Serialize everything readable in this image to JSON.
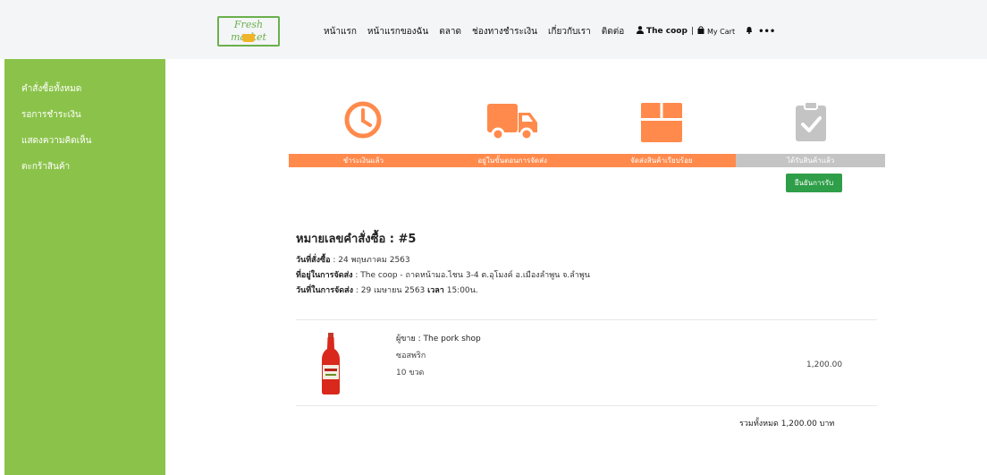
{
  "brand": {
    "logo_text": "Fresh market"
  },
  "nav": {
    "items": [
      "หน้าแรก",
      "หน้าแรกของฉัน",
      "ตลาด",
      "ช่องทางชำระเงิน",
      "เกี่ยวกับเรา",
      "ติดต่อ"
    ]
  },
  "user": {
    "name": "The coop",
    "separator": "|",
    "cart_label": "My Cart",
    "more": "•••"
  },
  "sidebar": {
    "items": [
      "คำสั่งซื้อทั้งหมด",
      "รอการชำระเงิน",
      "แสดงความคิดเห็น",
      "ตะกร้าสินค้า"
    ]
  },
  "steps": [
    {
      "label": "ชำระเงินแล้ว",
      "icon": "clock-icon",
      "status": "done"
    },
    {
      "label": "อยู่ในขั้นตอนการจัดส่ง",
      "icon": "truck-icon",
      "status": "done"
    },
    {
      "label": "จัดส่งสินค้าเรียบร้อย",
      "icon": "box-icon",
      "status": "done"
    },
    {
      "label": "ได้รับสินค้าแล้ว",
      "icon": "clipboard-check-icon",
      "status": "pending"
    }
  ],
  "confirm_button": "ยืนยันการรับ",
  "order": {
    "title": "หมายเลขคำสั่งซื้อ : #5",
    "order_date_label": "วันที่สั่งซื้อ",
    "order_date": " : 24 พฤษภาคม 2563",
    "address_label": "ที่อยู่ในการจัดส่ง",
    "address": " : The coop - ถาดหน้ามอ.ไชน 3-4 ต.อุโมงค์ อ.เมืองลำพูน จ.ลำพูน",
    "delivery_label": "วันที่ในการจัดส่ง",
    "delivery_date": " : 29 เมษายน 2563 ",
    "time_label": "เวลา",
    "time": " 15:00น."
  },
  "item": {
    "seller": "ผู้ขาย : The pork shop",
    "name": "ซอสพริก",
    "qty": "10 ขวด",
    "price": "1,200.00"
  },
  "total": "รวมทั้งหมด 1,200.00 บาท",
  "colors": {
    "accent": "#ff8a4c",
    "sidebar": "#8bc34a",
    "confirm": "#2e9e48",
    "inactive": "#c4c4c4"
  }
}
